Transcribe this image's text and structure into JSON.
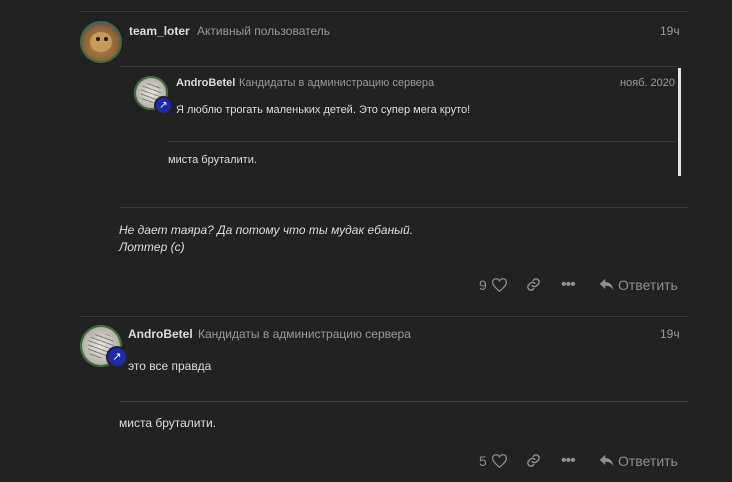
{
  "post1": {
    "username": "team_loter",
    "user_title": "Активный пользователь",
    "date": "19ч",
    "quote": {
      "username": "AndroBetel",
      "user_title": "Кандидаты в администрацию сервера",
      "date": "нояб. 2020",
      "text": "Я люблю трогать маленьких детей. Это супер мега круто!",
      "signature": "миста бруталити."
    },
    "body_line1": "Не дает таяра? Да потому что ты мудак ебаный.",
    "body_line2": "Лоттер (с)",
    "likes": "9",
    "reply_label": "Ответить"
  },
  "post2": {
    "username": "AndroBetel",
    "user_title": "Кандидаты в администрацию сервера",
    "date": "19ч",
    "body": "это все правда",
    "signature": "миста бруталити.",
    "likes": "5",
    "reply_label": "Ответить"
  },
  "icons": {
    "heart": "heart-icon",
    "link": "link-icon",
    "more": "ellipsis-icon",
    "reply": "reply-icon",
    "flair": "hammer-icon"
  }
}
